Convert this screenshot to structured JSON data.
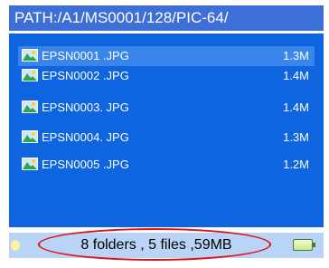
{
  "path": "PATH:/A1/MS0001/128/PIC-64/",
  "files": [
    {
      "name": "EPSN0001 .JPG",
      "size": "1.3M",
      "icon": "image-file-icon",
      "selected": true
    },
    {
      "name": "EPSN0002 .JPG",
      "size": "1.4M",
      "icon": "image-file-icon",
      "selected": false
    },
    {
      "name": "EPSN0003. JPG",
      "size": "1.4M",
      "icon": "image-file-icon",
      "selected": false
    },
    {
      "name": "EPSN0004. JPG",
      "size": "1.3M",
      "icon": "image-file-icon",
      "selected": false
    },
    {
      "name": "EPSN0005 .JPG",
      "size": "1.2M",
      "icon": "image-file-icon",
      "selected": false
    }
  ],
  "status": {
    "summary": "8 folders , 5 files ,59MB",
    "battery_icon": "battery-icon",
    "disc_icon": "disc-icon"
  },
  "colors": {
    "path_bar": "#3d6fd6",
    "file_panel": "#0f64e0",
    "selected_row": "#3a85ea",
    "status_bar": "#b9d4f6",
    "highlight_ellipse": "#e01010"
  }
}
